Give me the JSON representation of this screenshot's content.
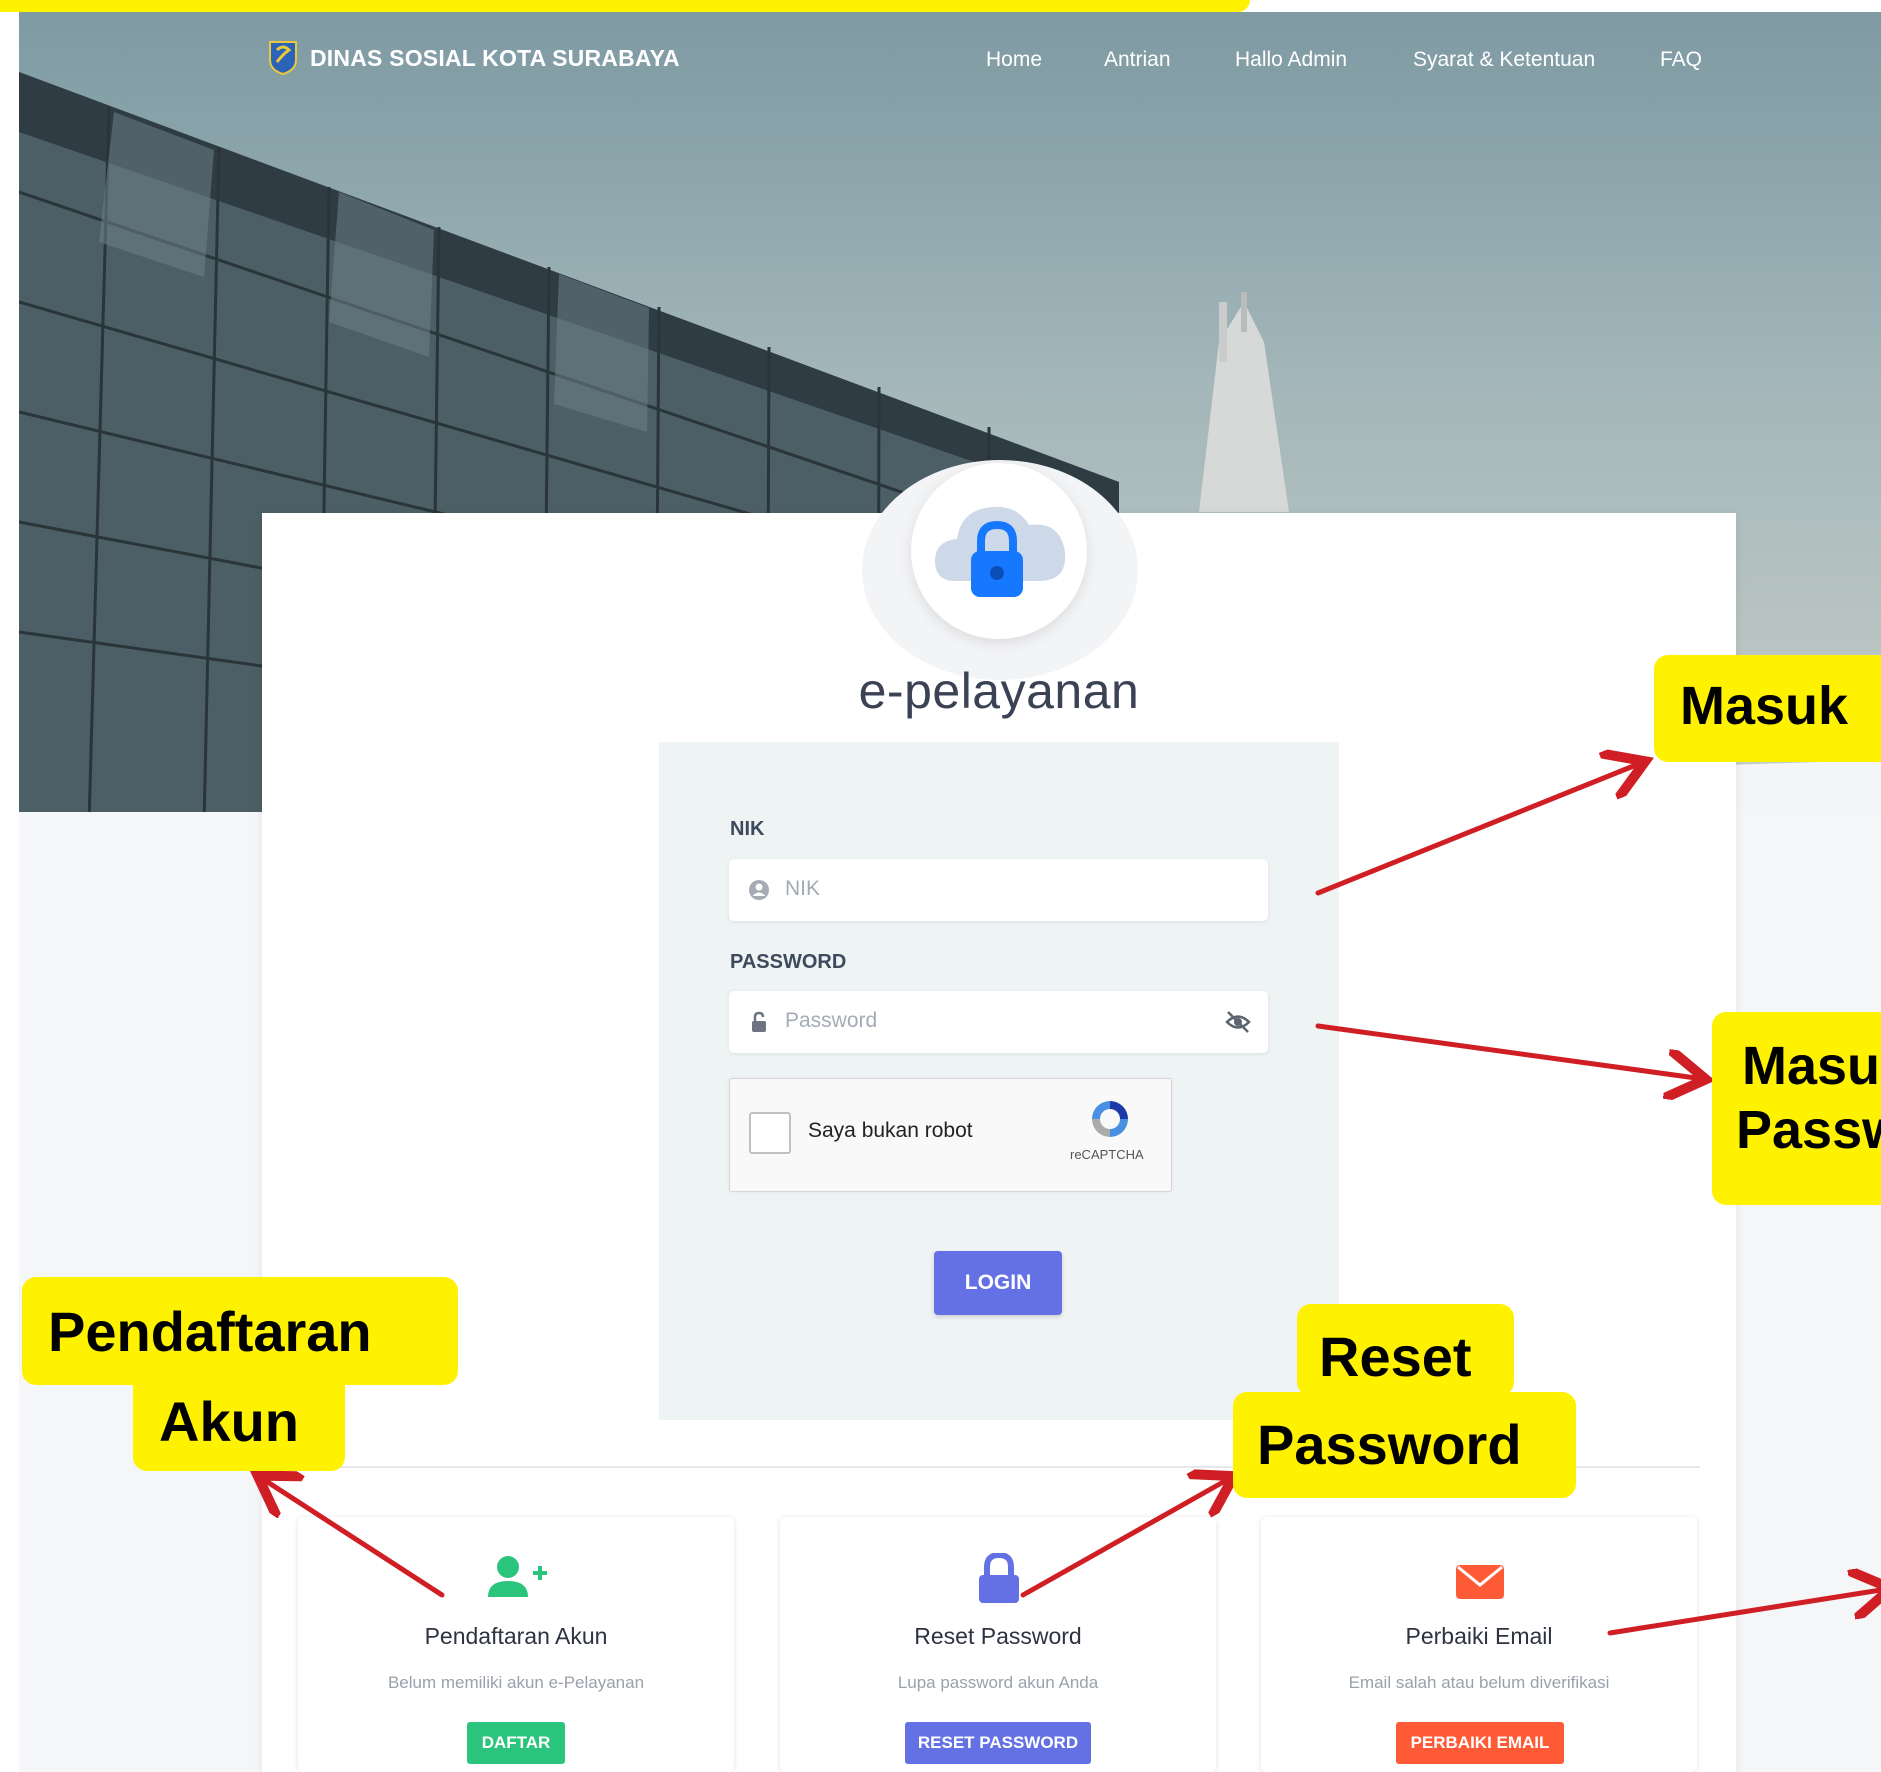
{
  "nav": {
    "brand": "DINAS SOSIAL KOTA SURABAYA",
    "links": [
      "Home",
      "Antrian",
      "Hallo Admin",
      "Syarat & Ketentuan",
      "FAQ"
    ]
  },
  "app": {
    "title": "e-pelayanan"
  },
  "login": {
    "nik_label": "NIK",
    "nik_placeholder": "NIK",
    "password_label": "PASSWORD",
    "password_placeholder": "Password",
    "captcha_text": "Saya bukan robot",
    "captcha_brand": "reCAPTCHA",
    "submit": "LOGIN"
  },
  "features": [
    {
      "title": "Pendaftaran Akun",
      "desc": "Belum memiliki akun e-Pelayanan",
      "button": "DAFTAR",
      "icon": "user-plus-icon",
      "color": "#2bc47d"
    },
    {
      "title": "Reset Password",
      "desc": "Lupa password akun Anda",
      "button": "RESET PASSWORD",
      "icon": "lock-icon",
      "color": "#6371e4"
    },
    {
      "title": "Perbaiki Email",
      "desc": "Email salah atau belum diverifikasi",
      "button": "PERBAIKI EMAIL",
      "icon": "envelope-icon",
      "color": "#ff5a36"
    }
  ],
  "annotations": {
    "nik": "Masuk",
    "password": [
      "Masu",
      "Passw"
    ],
    "register": [
      "Pendaftaran",
      "Akun"
    ],
    "reset": [
      "Reset",
      "Password"
    ]
  },
  "colors": {
    "annotation_bg": "#fff200",
    "arrow": "#d01f24",
    "primary": "#6371e4"
  }
}
